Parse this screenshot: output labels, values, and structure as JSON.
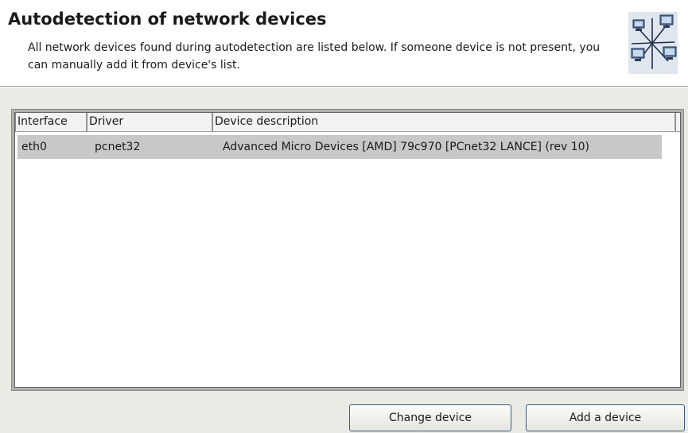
{
  "header": {
    "title": "Autodetection of network devices",
    "description": "All network devices found during autodetection are listed below. If someone device is not present, you can manually add it from device's list.",
    "icon": "network-computers-icon"
  },
  "device_list": {
    "columns": [
      "Interface",
      "Driver",
      "Device description"
    ],
    "rows": [
      {
        "interface": "eth0",
        "driver": "pcnet32",
        "description": "Advanced Micro Devices [AMD] 79c970 [PCnet32 LANCE] (rev 10)",
        "selected": true
      }
    ]
  },
  "buttons": {
    "change_label": "Change device",
    "add_label": "Add a device"
  },
  "colors": {
    "selected_row": "#c8c8c8",
    "panel_background": "#ebebe6",
    "button_border": "#3e5a80"
  }
}
